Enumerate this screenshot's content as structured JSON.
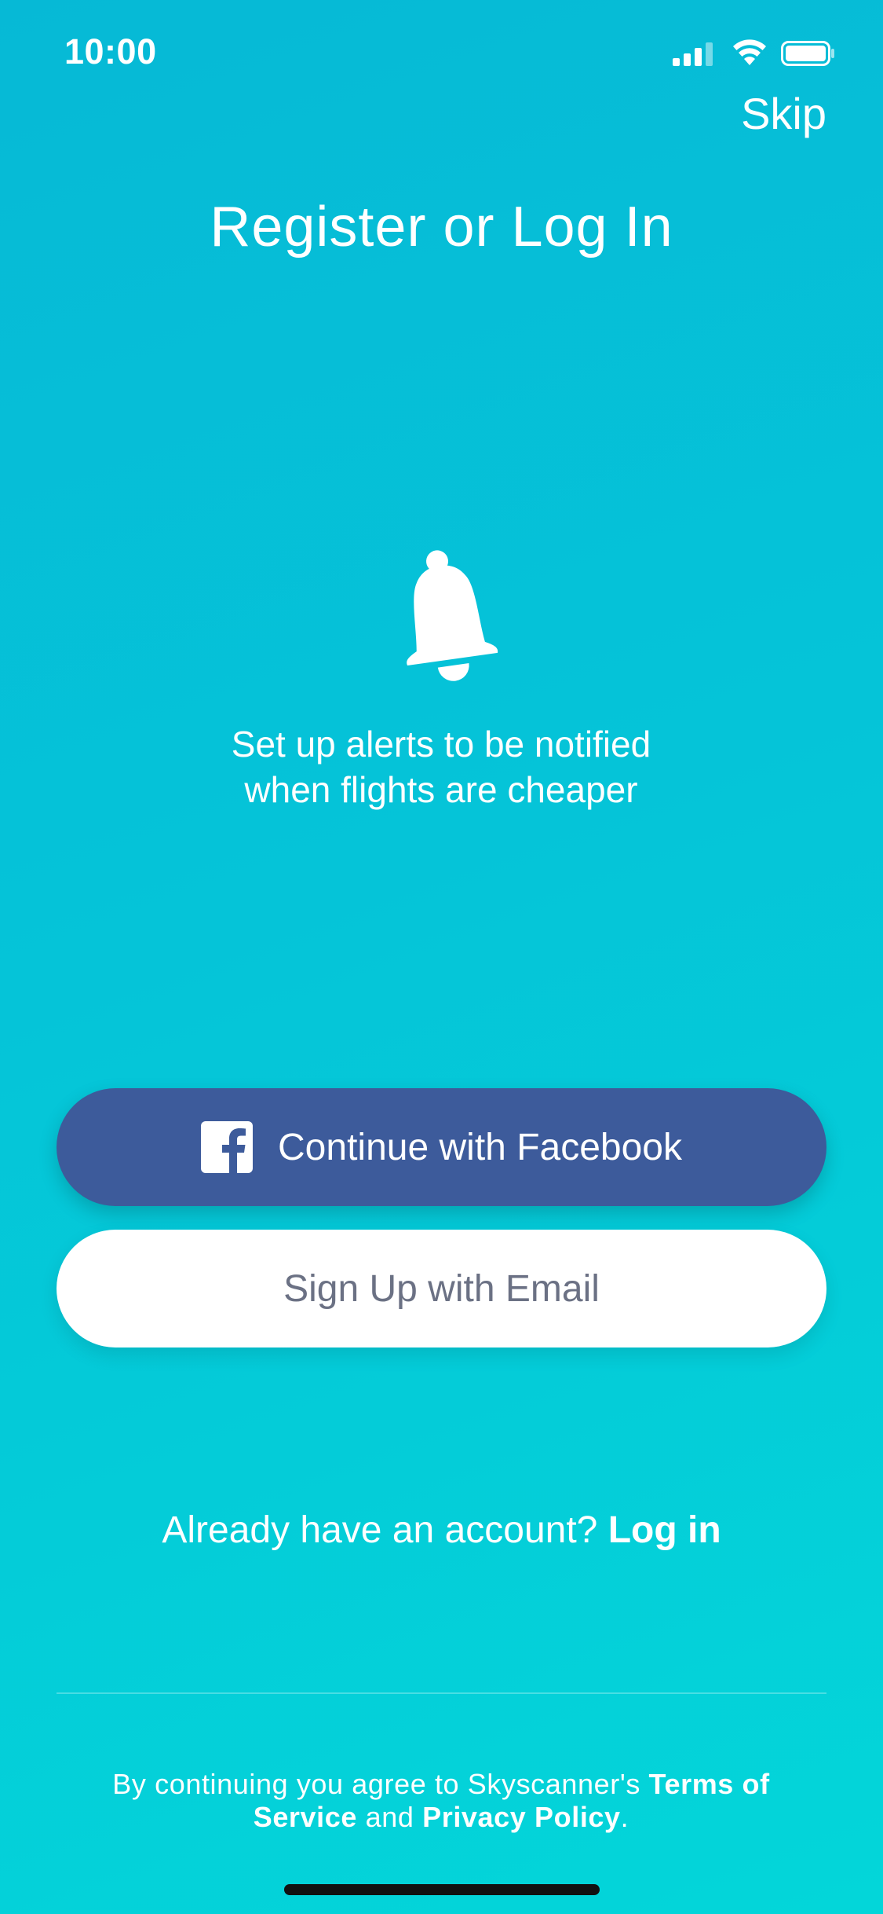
{
  "status_bar": {
    "time": "10:00"
  },
  "top": {
    "skip_label": "Skip",
    "title": "Register or Log In"
  },
  "alert": {
    "icon": "bell-icon",
    "line1": "Set up alerts to be notified",
    "line2": "when flights are cheaper"
  },
  "buttons": {
    "facebook_label": "Continue with Facebook",
    "email_label": "Sign Up with Email"
  },
  "login": {
    "prompt": "Already have an account?",
    "link_label": "Log in"
  },
  "legal": {
    "prefix": "By continuing you agree to Skyscanner's",
    "terms_label": "Terms of Service",
    "conjunction": "and",
    "privacy_label": "Privacy Policy",
    "suffix": "."
  },
  "colors": {
    "background_top": "#06b9d6",
    "background_bottom": "#03d6d9",
    "facebook_blue": "#3d5b9b",
    "email_text": "#6b7184"
  }
}
